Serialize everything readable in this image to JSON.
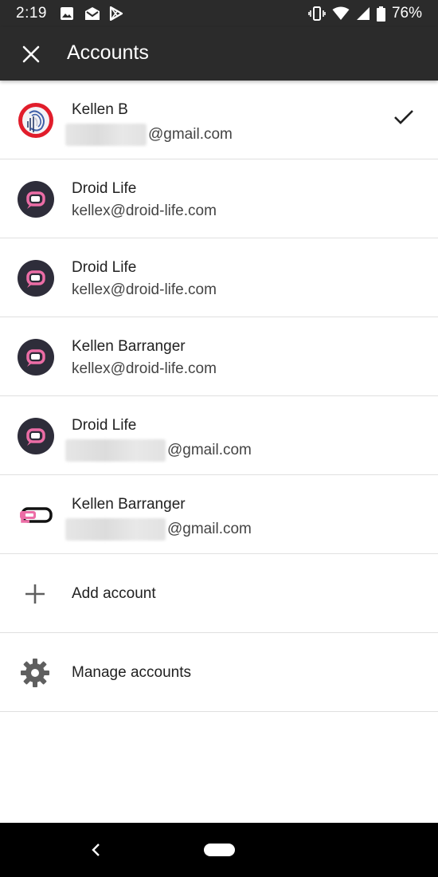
{
  "status_bar": {
    "time": "2:19",
    "battery": "76%",
    "notification_icons": [
      "image-icon",
      "mail-icon",
      "play-store-icon"
    ],
    "system_icons": [
      "vibrate-icon",
      "wifi-icon",
      "signal-icon",
      "battery-icon"
    ]
  },
  "app_bar": {
    "title": "Accounts",
    "close_icon": "close-icon"
  },
  "accounts": [
    {
      "name": "Kellen B",
      "email": "@gmail.com",
      "email_redacted": true,
      "selected": true,
      "avatar": "red-avatar"
    },
    {
      "name": "Droid Life",
      "email": "kellex@droid-life.com",
      "email_redacted": false,
      "selected": false,
      "avatar": "droid-life-avatar"
    },
    {
      "name": "Droid Life",
      "email": "kellex@droid-life.com",
      "email_redacted": false,
      "selected": false,
      "avatar": "droid-life-avatar"
    },
    {
      "name": "Kellen Barranger",
      "email": "kellex@droid-life.com",
      "email_redacted": false,
      "selected": false,
      "avatar": "droid-life-avatar"
    },
    {
      "name": "Droid Life",
      "email": "@gmail.com",
      "email_redacted": true,
      "selected": false,
      "avatar": "droid-life-avatar"
    },
    {
      "name": "Kellen Barranger",
      "email": "@gmail.com",
      "email_redacted": true,
      "selected": false,
      "avatar": "droid-life-logo"
    }
  ],
  "actions": {
    "add_account": "Add account",
    "manage_accounts": "Manage accounts"
  },
  "colors": {
    "app_bar": "#2b2b2b",
    "divider": "#e0e0e0",
    "text_primary": "#212121",
    "droid_pink": "#ec6da6",
    "avatar_dark": "#2e2d3a",
    "avatar_red": "#e11d2b"
  }
}
